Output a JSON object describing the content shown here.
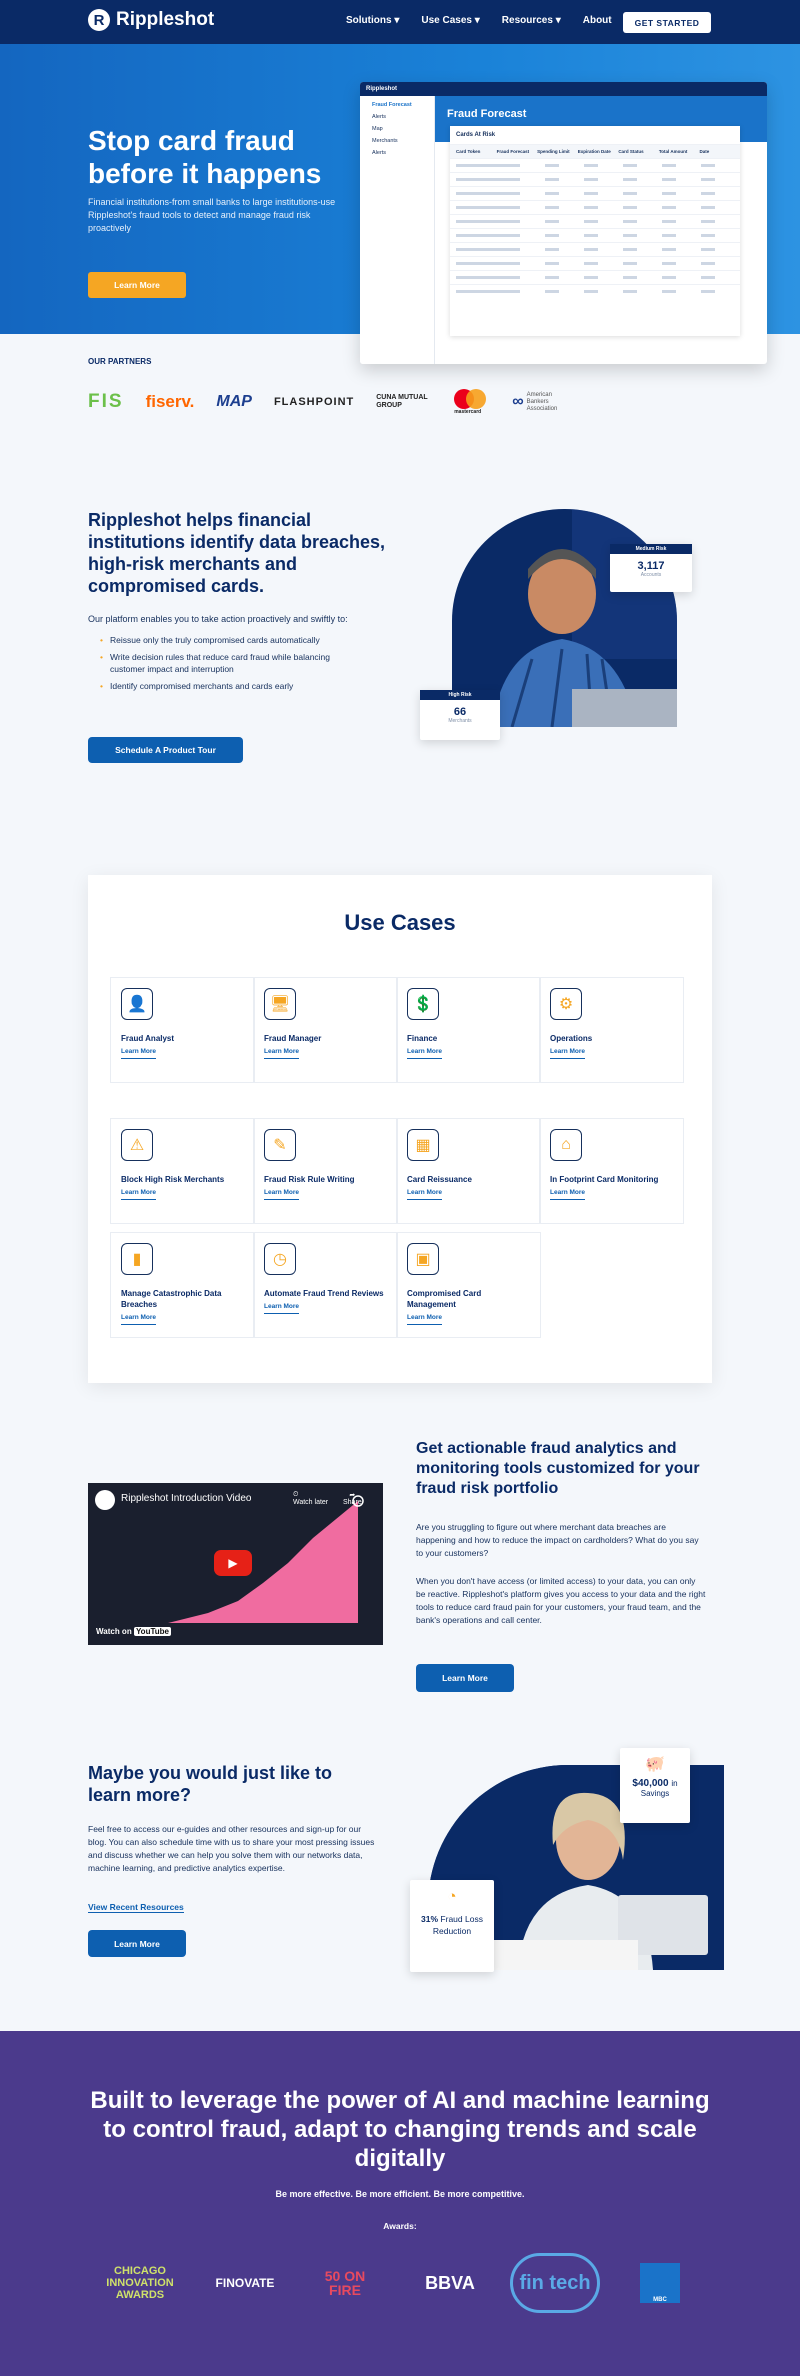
{
  "nav": {
    "brand": "Rippleshot",
    "links": [
      "Solutions",
      "Use Cases",
      "Resources",
      "About"
    ],
    "cta": "GET STARTED"
  },
  "hero": {
    "title": "Stop card fraud before it happens",
    "subtitle": "Financial institutions-from small banks to large institutions-use Rippleshot's fraud tools to detect and manage fraud risk proactively",
    "button": "Learn More",
    "dashboard": {
      "brand": "Rippleshot",
      "menu": [
        "Fraud Forecast",
        "Alerts",
        "Map",
        "Merchants",
        "Alerts"
      ],
      "header": "Fraud Forecast",
      "card_title": "Cards At Risk",
      "columns": [
        "Card Token",
        "Fraud Forecast",
        "Spending Limit",
        "Expiration Date",
        "Card Status",
        "Total Amount",
        "Date"
      ],
      "rows": 10
    }
  },
  "partners": {
    "label": "OUR PARTNERS",
    "logos": [
      "FIS",
      "fiserv.",
      "MAP",
      "FLASHPOINT",
      "CUNA MUTUAL GROUP",
      "mastercard",
      "American Bankers Association"
    ]
  },
  "features": {
    "title": "Rippleshot helps financial institutions identify data breaches, high-risk merchants and compromised cards.",
    "lead": "Our platform enables you to take action proactively and swiftly to:",
    "items": [
      "Reissue only the truly compromised cards automatically",
      "Write decision rules that reduce card fraud while balancing customer impact and interruption",
      "Identify compromised merchants and cards early"
    ],
    "button": "Schedule A Product Tour",
    "stat1": {
      "label": "Medium Risk",
      "value": "3,117",
      "sub": "Accounts"
    },
    "stat2": {
      "label": "High Risk",
      "value": "66",
      "sub": "Merchants"
    }
  },
  "use_cases": {
    "title": "Use Cases",
    "learn": "Learn More",
    "items": [
      {
        "title": "Fraud Analyst",
        "icon": "👤"
      },
      {
        "title": "Fraud Manager",
        "icon": "🖥"
      },
      {
        "title": "Finance",
        "icon": "💲"
      },
      {
        "title": "Operations",
        "icon": "⚙"
      },
      {
        "title": "Block High Risk Merchants",
        "icon": "⚠"
      },
      {
        "title": "Fraud Risk Rule Writing",
        "icon": "✎"
      },
      {
        "title": "Card Reissuance",
        "icon": "▦"
      },
      {
        "title": "In Footprint Card Monitoring",
        "icon": "⌂"
      },
      {
        "title": "Manage Catastrophic Data Breaches",
        "icon": "▮"
      },
      {
        "title": "Automate Fraud Trend Reviews",
        "icon": "◷"
      },
      {
        "title": "Compromised Card Management",
        "icon": "▣"
      }
    ]
  },
  "video": {
    "title": "Rippleshot Introduction Video",
    "watch": "Watch on",
    "youtube": "YouTube",
    "later": "Watch later",
    "share": "Share"
  },
  "analytics": {
    "title": "Get actionable fraud analytics and monitoring tools customized for your fraud risk portfolio",
    "p1": "Are you struggling to figure out where merchant data breaches are happening and how to reduce the impact on cardholders? What do you say to your customers?",
    "p2": "When you don't have access (or limited access) to your data, you can only be reactive. Rippleshot's platform gives you access to your data and the right tools to reduce card fraud pain for your customers, your fraud team, and the bank's operations and call center.",
    "button": "Learn More"
  },
  "learn": {
    "title": "Maybe you would just like to learn more?",
    "p": "Feel free to access our e-guides and other resources and sign-up for our blog. You can also schedule time with us to share your most pressing issues and discuss whether we can help you solve them with our networks data, machine learning, and predictive analytics expertise.",
    "link": "View Recent Resources",
    "button": "Learn More",
    "stat1": {
      "value": "$40,000",
      "unit": "in",
      "sub": "Savings"
    },
    "stat2": {
      "value": "31%",
      "sub": "Fraud Loss Reduction"
    }
  },
  "footer": {
    "title": "Built to leverage the power of AI and machine learning to control fraud, adapt to changing trends and scale digitally",
    "tagline": "Be more effective.  Be more efficient.  Be more competitive.",
    "awards_label": "Awards:",
    "awards": [
      "CHICAGO INNOVATION AWARDS",
      "FINOVATE",
      "50 ON FIRE",
      "BBVA",
      "fin tech",
      "MBC"
    ]
  },
  "colors": {
    "navy": "#0a2a66",
    "blue": "#1a73c9",
    "orange": "#f5a623",
    "purple": "#4b3a8c"
  }
}
